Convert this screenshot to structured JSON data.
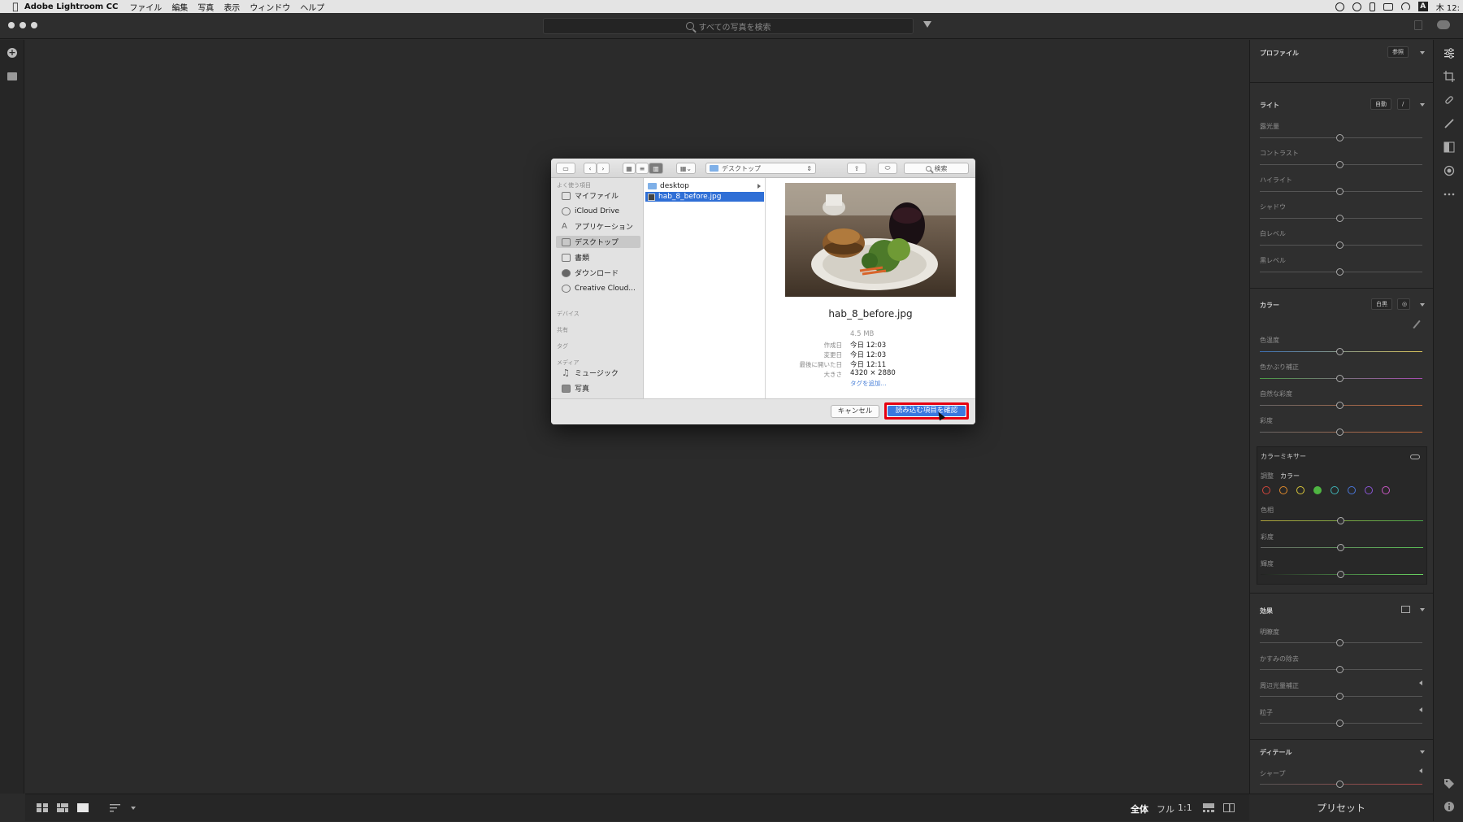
{
  "menubar": {
    "app": "Adobe Lightroom CC",
    "items": [
      "ファイル",
      "編集",
      "写真",
      "表示",
      "ウィンドウ",
      "ヘルプ"
    ],
    "clock": "木 12:"
  },
  "titlebar": {
    "search_placeholder": "すべての写真を検索"
  },
  "dialog": {
    "location": "デスクトップ",
    "search_placeholder": "検索",
    "sidebar": {
      "favorites_header": "よく使う項目",
      "favorites": [
        "マイファイル",
        "iCloud Drive",
        "アプリケーション",
        "デスクトップ",
        "書類",
        "ダウンロード",
        "Creative Cloud..."
      ],
      "devices_header": "デバイス",
      "shared_header": "共有",
      "tags_header": "タグ",
      "media_header": "メディア",
      "media": [
        "ミュージック",
        "写真"
      ]
    },
    "files": [
      "desktop",
      "hab_8_before.jpg"
    ],
    "preview": {
      "filename": "hab_8_before.jpg",
      "size": "4.5 MB",
      "created_label": "作成日",
      "created": "今日 12:03",
      "modified_label": "変更日",
      "modified": "今日 12:03",
      "opened_label": "最後に開いた日",
      "opened": "今日 12:11",
      "dimensions_label": "大きさ",
      "dimensions": "4320 × 2880",
      "add_tag": "タグを追加..."
    },
    "cancel_label": "キャンセル",
    "confirm_label": "読み込む項目を確認"
  },
  "panel": {
    "profile": {
      "title": "プロファイル",
      "browse": "参照"
    },
    "light": {
      "title": "ライト",
      "auto": "自動",
      "sliders": [
        "露光量",
        "コントラスト",
        "ハイライト",
        "シャドウ",
        "白レベル",
        "黒レベル"
      ]
    },
    "color": {
      "title": "カラー",
      "wb": "白黒",
      "sliders": [
        "色温度",
        "色かぶり補正",
        "自然な彩度",
        "彩度"
      ]
    },
    "mixer": {
      "title": "カラーミキサー",
      "adjust_label": "調整",
      "adjust_value": "カラー",
      "sliders": [
        "色相",
        "彩度",
        "輝度"
      ],
      "swatches": [
        "#d0453b",
        "#e08a2c",
        "#d9c63a",
        "#4fb542",
        "#3fb3b6",
        "#4a76d8",
        "#8a55d6",
        "#c957c4"
      ]
    },
    "effects": {
      "title": "効果",
      "sliders": [
        "明瞭度",
        "かすみの除去",
        "周辺光量補正",
        "粒子"
      ]
    },
    "detail": {
      "title": "ディテール",
      "sliders": [
        "シャープ"
      ]
    },
    "presets": "プリセット"
  },
  "bottombar": {
    "views": [
      "全体",
      "フル",
      "1:1"
    ]
  }
}
